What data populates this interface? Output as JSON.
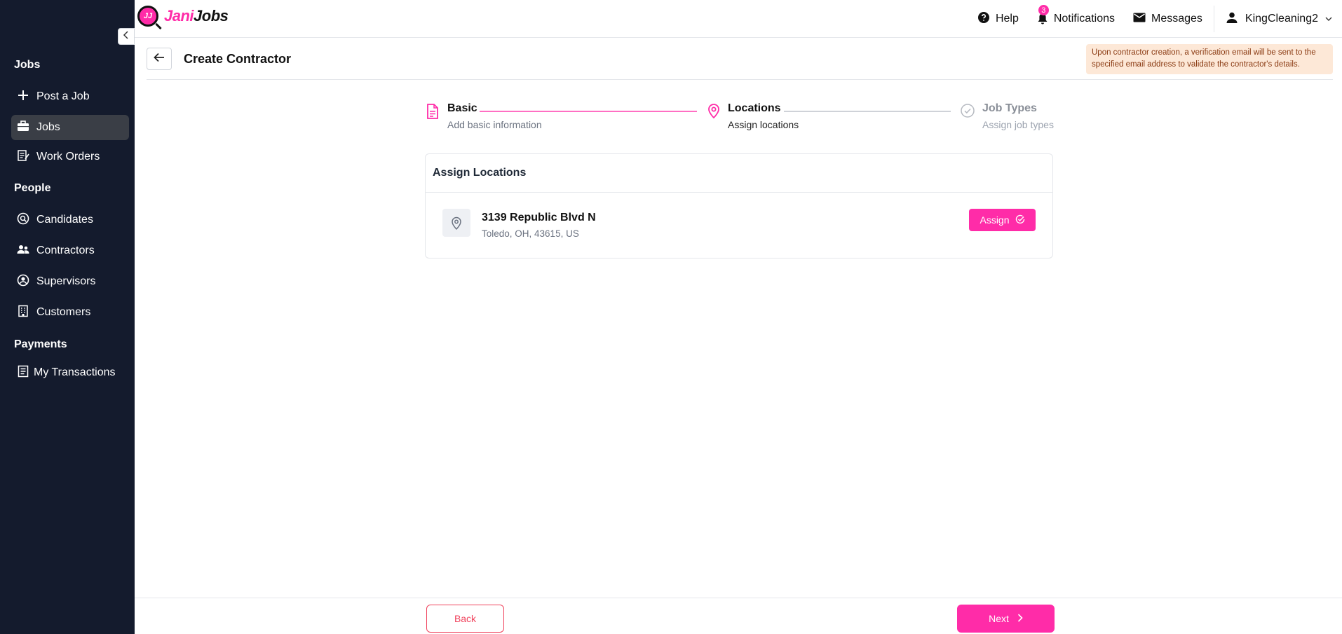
{
  "sidebar": {
    "sections": [
      {
        "title": "Jobs"
      },
      {
        "title": "People"
      },
      {
        "title": "Payments"
      }
    ],
    "items": [
      {
        "label": "Post a Job",
        "icon": "plus-icon"
      },
      {
        "label": "Jobs",
        "icon": "briefcase-icon",
        "active": true
      },
      {
        "label": "Work Orders",
        "icon": "work-order-icon"
      },
      {
        "label": "Candidates",
        "icon": "search-person-icon"
      },
      {
        "label": "Contractors",
        "icon": "people-icon"
      },
      {
        "label": "Supervisors",
        "icon": "user-circle-icon"
      },
      {
        "label": "Customers",
        "icon": "building-icon"
      },
      {
        "label": "My Transactions",
        "icon": "receipt-icon"
      }
    ]
  },
  "header": {
    "logo_jani": "Jani",
    "logo_jobs": "Jobs",
    "logo_mark": "JJ",
    "help": "Help",
    "notifications": "Notifications",
    "notification_count": "3",
    "messages": "Messages",
    "user": "KingCleaning2"
  },
  "page": {
    "title": "Create Contractor",
    "notice": "Upon contractor creation, a verification email will be sent to the specified email address to validate the contractor's details."
  },
  "stepper": {
    "steps": [
      {
        "title": "Basic",
        "subtitle": "Add basic information",
        "state": "done"
      },
      {
        "title": "Locations",
        "subtitle": "Assign locations",
        "state": "current"
      },
      {
        "title": "Job Types",
        "subtitle": "Assign job types",
        "state": "pending"
      }
    ]
  },
  "assign_locations": {
    "heading": "Assign Locations",
    "locations": [
      {
        "name": "3139 Republic Blvd N",
        "address": "Toledo, OH, 43615, US",
        "action": "Assign"
      }
    ]
  },
  "footer": {
    "back": "Back",
    "next": "Next"
  },
  "colors": {
    "accent": "#ff2ca8",
    "sidebar_bg": "#141b2d",
    "danger": "#f0435d",
    "notice_bg": "#fde8d7"
  }
}
